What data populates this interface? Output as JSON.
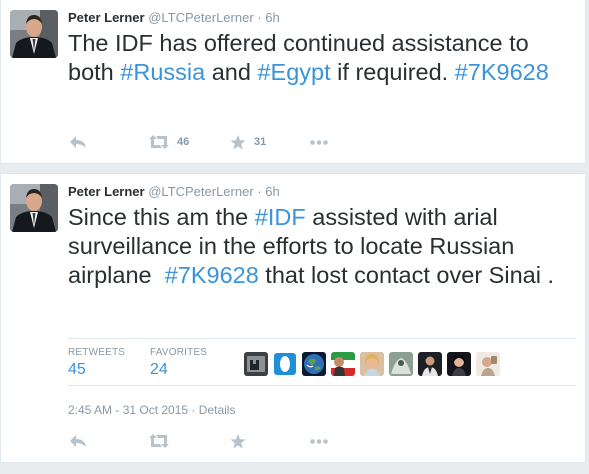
{
  "tweets": [
    {
      "author": {
        "name": "Peter Lerner",
        "handle": "@LTCPeterLerner",
        "separator": "·",
        "time": "6h"
      },
      "text": {
        "part1": "The IDF has offered continued assistance to both ",
        "tag1": "#Russia",
        "part2": " and ",
        "tag2": "#Egypt",
        "part3": " if required. ",
        "tag3": "#7K9628"
      },
      "actions": {
        "retweet_count": "46",
        "favorite_count": "31"
      }
    },
    {
      "author": {
        "name": "Peter Lerner",
        "handle": "@LTCPeterLerner",
        "separator": "·",
        "time": "6h"
      },
      "text": {
        "part1": "Since this am the ",
        "tag1": "#IDF",
        "part2": " assisted with arial surveillance in the efforts to locate Russian airplane  ",
        "tag2": "#7K9628",
        "part3": " that lost contact over Sinai ."
      },
      "stats": {
        "retweets_label": "RETWEETS",
        "retweets_value": "45",
        "favorites_label": "FAVORITES",
        "favorites_value": "24"
      },
      "date": {
        "time": "2:45 AM - 31 Oct 2015",
        "separator": "·",
        "details_link": "Details"
      }
    }
  ],
  "colors": {
    "link": "#3b94d9",
    "muted": "#8899a6",
    "text": "#292f33",
    "border": "#e1e8ed",
    "background": "#e9ecee"
  }
}
